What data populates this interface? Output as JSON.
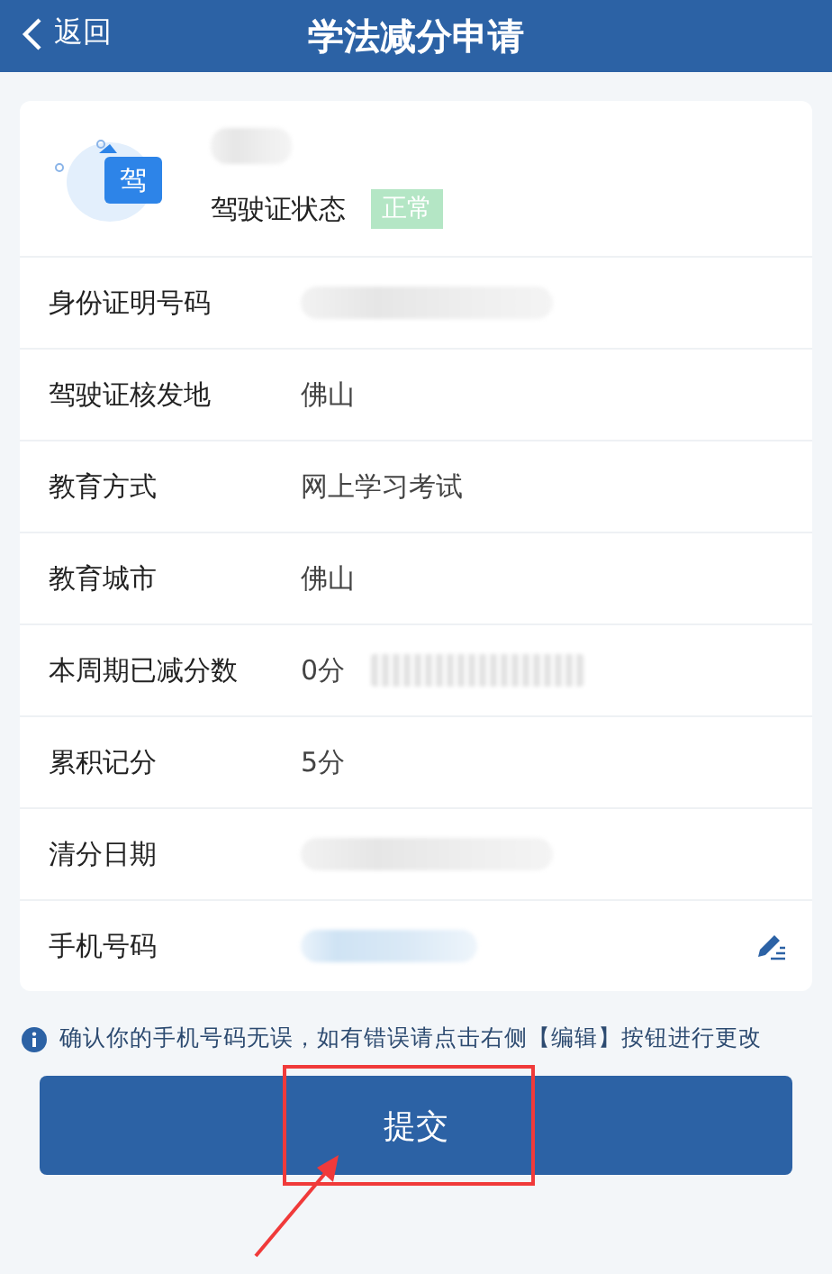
{
  "header": {
    "back": "返回",
    "title": "学法减分申请"
  },
  "profile": {
    "status_label": "驾驶证状态",
    "status": "正常",
    "icon_text": "驾",
    "name_redacted": true
  },
  "rows": [
    {
      "label": "身份证明号码",
      "value": null,
      "redacted": true,
      "editable": false
    },
    {
      "label": "驾驶证核发地",
      "value": "佛山",
      "redacted": false,
      "editable": false
    },
    {
      "label": "教育方式",
      "value": "网上学习考试",
      "redacted": false,
      "editable": false
    },
    {
      "label": "教育城市",
      "value": "佛山",
      "redacted": false,
      "editable": false
    },
    {
      "label": "本周期已减分数",
      "value": "0分",
      "redacted": true,
      "editable": false
    },
    {
      "label": "累积记分",
      "value": "5分",
      "redacted": false,
      "editable": false
    },
    {
      "label": "清分日期",
      "value": null,
      "redacted": true,
      "editable": false
    },
    {
      "label": "手机号码",
      "value": null,
      "redacted": true,
      "editable": true
    }
  ],
  "notice": "确认你的手机号码无误，如有错误请点击右侧【编辑】按钮进行更改",
  "submit": "提交"
}
